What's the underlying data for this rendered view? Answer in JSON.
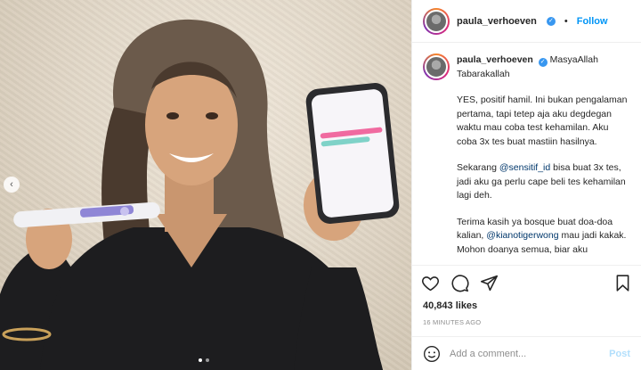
{
  "header": {
    "username": "paula_verhoeven",
    "follow_label": "Follow"
  },
  "caption": {
    "username": "paula_verhoeven",
    "first_line": "MasyaAllah",
    "second_line": "Tabarakallah",
    "para1": "YES, positif hamil. Ini bukan pengalaman pertama, tapi tetep aja aku degdegan waktu mau coba test kehamilan. Aku coba 3x tes buat mastiin hasilnya.",
    "para2_before": "Sekarang ",
    "para2_mention": "@sensitif_id",
    "para2_after": " bisa buat 3x tes, jadi aku ga perlu cape beli tes kehamilan lagi deh.",
    "para3_before": "Terima kasih ya bosque buat doa-doa kalian, ",
    "para3_mention": "@kianotigerwong",
    "para3_after": " mau jadi kakak. Mohon doanya semua, biar aku"
  },
  "likes": "40,843 likes",
  "timestamp": "16 MINUTES AGO",
  "comment": {
    "placeholder": "Add a comment...",
    "post_label": "Post"
  },
  "media": {
    "prev_glyph": "‹",
    "dots": 2,
    "active_dot": 1
  },
  "icons": {
    "like": "heart-icon",
    "comment": "comment-icon",
    "share": "paper-plane-icon",
    "save": "bookmark-icon",
    "emoji": "smiley-icon"
  }
}
